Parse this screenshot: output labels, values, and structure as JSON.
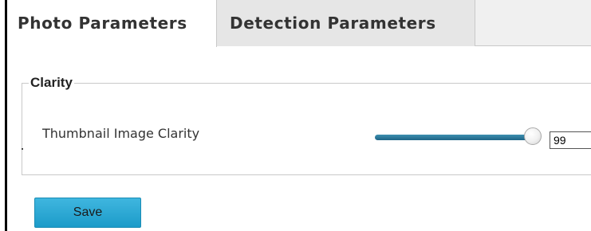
{
  "tabs": [
    {
      "label": "Photo Parameters",
      "active": true
    },
    {
      "label": "Detection Parameters",
      "active": false
    }
  ],
  "clarity": {
    "group_title": "Clarity",
    "field_label": "Thumbnail Image Clarity",
    "value": "99",
    "slider_fraction": 0.99
  },
  "actions": {
    "save_label": "Save"
  },
  "colors": {
    "accent": "#1c9bc9",
    "slider_track": "#2a7aa0"
  }
}
